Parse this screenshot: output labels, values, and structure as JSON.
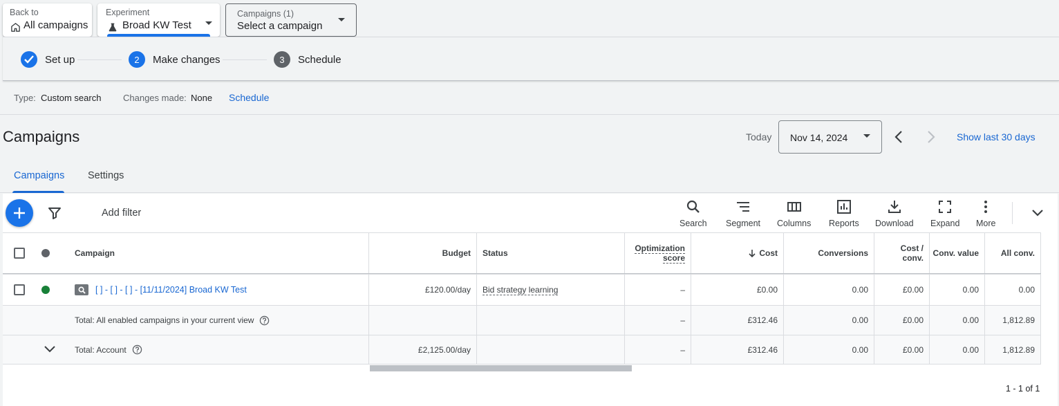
{
  "top": {
    "back": {
      "label": "Back to",
      "value": "All campaigns"
    },
    "experiment": {
      "label": "Experiment",
      "value": "Broad KW Test"
    },
    "campaign_select": {
      "label": "Campaigns (1)",
      "value": "Select a campaign"
    }
  },
  "stepper": {
    "steps": [
      {
        "number": "✓",
        "label": "Set up",
        "state": "done"
      },
      {
        "number": "2",
        "label": "Make changes",
        "state": "active"
      },
      {
        "number": "3",
        "label": "Schedule",
        "state": "pending"
      }
    ]
  },
  "info": {
    "type_label": "Type:",
    "type_value": "Custom search",
    "changes_label": "Changes made:",
    "changes_value": "None",
    "schedule_link": "Schedule"
  },
  "header": {
    "title": "Campaigns",
    "today_label": "Today",
    "date": "Nov 14, 2024",
    "show_last": "Show last 30 days"
  },
  "tabs": [
    {
      "label": "Campaigns",
      "active": true
    },
    {
      "label": "Settings",
      "active": false
    }
  ],
  "toolbar": {
    "add_filter": "Add filter",
    "tools": [
      "Search",
      "Segment",
      "Columns",
      "Reports",
      "Download",
      "Expand",
      "More"
    ]
  },
  "table": {
    "headers": {
      "campaign": "Campaign",
      "budget": "Budget",
      "status": "Status",
      "opt_line1": "Optimization",
      "opt_line2": "score",
      "cost": "Cost",
      "conversions": "Conversions",
      "cost_conv_line1": "Cost /",
      "cost_conv_line2": "conv.",
      "conv_value": "Conv. value",
      "all_conv": "All conv."
    },
    "rows": [
      {
        "campaign": "[        ] - [        ] - [        ] - [11/11/2024] Broad KW Test",
        "budget": "£120.00/day",
        "status": "Bid strategy learning",
        "opt": "–",
        "cost": "£0.00",
        "conversions": "0.00",
        "cost_conv": "£0.00",
        "conv_value": "0.00",
        "all_conv": "0.00"
      }
    ],
    "totals": [
      {
        "label": "Total: All enabled campaigns in your current view",
        "budget": "",
        "opt": "–",
        "cost": "£312.46",
        "conversions": "0.00",
        "cost_conv": "£0.00",
        "conv_value": "0.00",
        "all_conv": "1,812.89"
      },
      {
        "label": "Total: Account",
        "budget": "£2,125.00/day",
        "opt": "–",
        "cost": "£312.46",
        "conversions": "0.00",
        "cost_conv": "£0.00",
        "conv_value": "0.00",
        "all_conv": "1,812.89"
      }
    ],
    "pagination": "1 - 1 of 1"
  },
  "colors": {
    "accent": "#1a73e8",
    "link": "#1967d2",
    "enabled": "#188038",
    "muted": "#5f6368"
  }
}
